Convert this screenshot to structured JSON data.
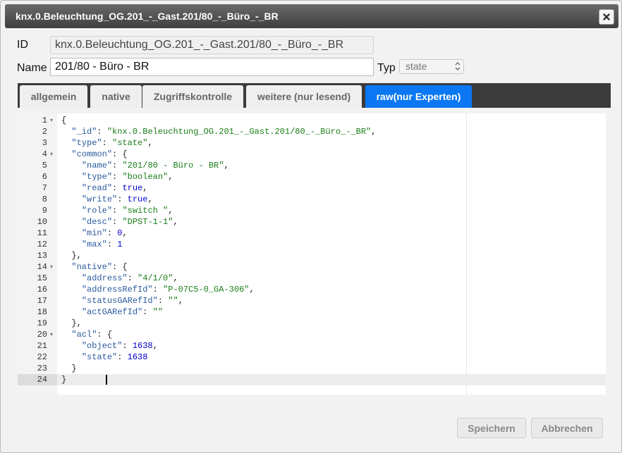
{
  "dialog": {
    "title": "knx.0.Beleuchtung_OG.201_-_Gast.201/80_-_Büro_-_BR"
  },
  "form": {
    "id_label": "ID",
    "id_value": "knx.0.Beleuchtung_OG.201_-_Gast.201/80_-_Büro_-_BR",
    "name_label": "Name",
    "name_value": "201/80 - Büro - BR",
    "type_label": "Typ",
    "type_value": "state"
  },
  "tabs": [
    {
      "label": "allgemein",
      "active": false
    },
    {
      "label": "native",
      "active": false
    },
    {
      "label": "Zugriffskontrolle",
      "active": false
    },
    {
      "label": "weitere (nur lesend)",
      "active": false
    },
    {
      "label": "raw(nur Experten)",
      "active": true
    }
  ],
  "editor": {
    "lines": [
      {
        "n": "1",
        "fold": true,
        "tokens": [
          [
            "p",
            "{"
          ]
        ]
      },
      {
        "n": "2",
        "fold": false,
        "tokens": [
          [
            "p",
            "  "
          ],
          [
            "key",
            "\"_id\""
          ],
          [
            "p",
            ": "
          ],
          [
            "str",
            "\"knx.0.Beleuchtung_OG.201_-_Gast.201/80_-_Büro_-_BR\""
          ],
          [
            "p",
            ","
          ]
        ]
      },
      {
        "n": "3",
        "fold": false,
        "tokens": [
          [
            "p",
            "  "
          ],
          [
            "key",
            "\"type\""
          ],
          [
            "p",
            ": "
          ],
          [
            "str",
            "\"state\""
          ],
          [
            "p",
            ","
          ]
        ]
      },
      {
        "n": "4",
        "fold": true,
        "tokens": [
          [
            "p",
            "  "
          ],
          [
            "key",
            "\"common\""
          ],
          [
            "p",
            ": {"
          ]
        ]
      },
      {
        "n": "5",
        "fold": false,
        "tokens": [
          [
            "p",
            "    "
          ],
          [
            "key",
            "\"name\""
          ],
          [
            "p",
            ": "
          ],
          [
            "str",
            "\"201/80 - Büro - BR\""
          ],
          [
            "p",
            ","
          ]
        ]
      },
      {
        "n": "6",
        "fold": false,
        "tokens": [
          [
            "p",
            "    "
          ],
          [
            "key",
            "\"type\""
          ],
          [
            "p",
            ": "
          ],
          [
            "str",
            "\"boolean\""
          ],
          [
            "p",
            ","
          ]
        ]
      },
      {
        "n": "7",
        "fold": false,
        "tokens": [
          [
            "p",
            "    "
          ],
          [
            "key",
            "\"read\""
          ],
          [
            "p",
            ": "
          ],
          [
            "bool",
            "true"
          ],
          [
            "p",
            ","
          ]
        ]
      },
      {
        "n": "8",
        "fold": false,
        "tokens": [
          [
            "p",
            "    "
          ],
          [
            "key",
            "\"write\""
          ],
          [
            "p",
            ": "
          ],
          [
            "bool",
            "true"
          ],
          [
            "p",
            ","
          ]
        ]
      },
      {
        "n": "9",
        "fold": false,
        "tokens": [
          [
            "p",
            "    "
          ],
          [
            "key",
            "\"role\""
          ],
          [
            "p",
            ": "
          ],
          [
            "str",
            "\"switch \""
          ],
          [
            "p",
            ","
          ]
        ]
      },
      {
        "n": "10",
        "fold": false,
        "tokens": [
          [
            "p",
            "    "
          ],
          [
            "key",
            "\"desc\""
          ],
          [
            "p",
            ": "
          ],
          [
            "str",
            "\"DPST-1-1\""
          ],
          [
            "p",
            ","
          ]
        ]
      },
      {
        "n": "11",
        "fold": false,
        "tokens": [
          [
            "p",
            "    "
          ],
          [
            "key",
            "\"min\""
          ],
          [
            "p",
            ": "
          ],
          [
            "num",
            "0"
          ],
          [
            "p",
            ","
          ]
        ]
      },
      {
        "n": "12",
        "fold": false,
        "tokens": [
          [
            "p",
            "    "
          ],
          [
            "key",
            "\"max\""
          ],
          [
            "p",
            ": "
          ],
          [
            "num",
            "1"
          ]
        ]
      },
      {
        "n": "13",
        "fold": false,
        "tokens": [
          [
            "p",
            "  },"
          ]
        ]
      },
      {
        "n": "14",
        "fold": true,
        "tokens": [
          [
            "p",
            "  "
          ],
          [
            "key",
            "\"native\""
          ],
          [
            "p",
            ": {"
          ]
        ]
      },
      {
        "n": "15",
        "fold": false,
        "tokens": [
          [
            "p",
            "    "
          ],
          [
            "key",
            "\"address\""
          ],
          [
            "p",
            ": "
          ],
          [
            "str",
            "\"4/1/0\""
          ],
          [
            "p",
            ","
          ]
        ]
      },
      {
        "n": "16",
        "fold": false,
        "tokens": [
          [
            "p",
            "    "
          ],
          [
            "key",
            "\"addressRefId\""
          ],
          [
            "p",
            ": "
          ],
          [
            "str",
            "\"P-07C5-0_GA-306\""
          ],
          [
            "p",
            ","
          ]
        ]
      },
      {
        "n": "17",
        "fold": false,
        "tokens": [
          [
            "p",
            "    "
          ],
          [
            "key",
            "\"statusGARefId\""
          ],
          [
            "p",
            ": "
          ],
          [
            "str",
            "\"\""
          ],
          [
            "p",
            ","
          ]
        ]
      },
      {
        "n": "18",
        "fold": false,
        "tokens": [
          [
            "p",
            "    "
          ],
          [
            "key",
            "\"actGARefId\""
          ],
          [
            "p",
            ": "
          ],
          [
            "str",
            "\"\""
          ]
        ]
      },
      {
        "n": "19",
        "fold": false,
        "tokens": [
          [
            "p",
            "  },"
          ]
        ]
      },
      {
        "n": "20",
        "fold": true,
        "tokens": [
          [
            "p",
            "  "
          ],
          [
            "key",
            "\"acl\""
          ],
          [
            "p",
            ": {"
          ]
        ]
      },
      {
        "n": "21",
        "fold": false,
        "tokens": [
          [
            "p",
            "    "
          ],
          [
            "key",
            "\"object\""
          ],
          [
            "p",
            ": "
          ],
          [
            "num",
            "1638"
          ],
          [
            "p",
            ","
          ]
        ]
      },
      {
        "n": "22",
        "fold": false,
        "tokens": [
          [
            "p",
            "    "
          ],
          [
            "key",
            "\"state\""
          ],
          [
            "p",
            ": "
          ],
          [
            "num",
            "1638"
          ]
        ]
      },
      {
        "n": "23",
        "fold": false,
        "tokens": [
          [
            "p",
            "  }"
          ]
        ]
      },
      {
        "n": "24",
        "fold": false,
        "active": true,
        "tokens": [
          [
            "p",
            "}"
          ]
        ]
      }
    ]
  },
  "buttons": {
    "save_label": "Speichern",
    "cancel_label": "Abbrechen"
  },
  "colors": {
    "accent": "#0b77f2",
    "titlebar": "#4a4a4a",
    "tabbar": "#3b3b3b"
  },
  "icons": {
    "close": "close-icon",
    "fold": "fold-arrow-icon",
    "select": "select-chevron-icon"
  }
}
